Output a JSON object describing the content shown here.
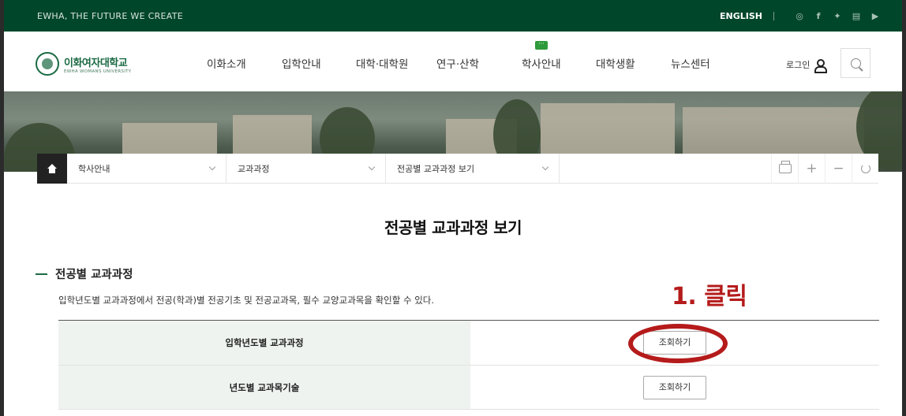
{
  "topbar": {
    "slogan": "EWHA, THE FUTURE WE CREATE",
    "english": "ENGLISH",
    "sns_icons": [
      "instagram-icon",
      "facebook-icon",
      "twitter-icon",
      "chat-icon",
      "youtube-icon"
    ]
  },
  "logo": {
    "name_ko": "이화여자대학교",
    "name_en": "EWHA WOMANS UNIVERSITY"
  },
  "nav": {
    "items": [
      {
        "label": "이화소개"
      },
      {
        "label": "입학안내"
      },
      {
        "label": "대학·대학원"
      },
      {
        "label": "연구·산학"
      },
      {
        "label": "학사안내",
        "badge": "···"
      },
      {
        "label": "대학생활"
      },
      {
        "label": "뉴스센터"
      }
    ],
    "login": "로그인"
  },
  "breadcrumb": {
    "items": [
      {
        "label": "학사안내"
      },
      {
        "label": "교과과정"
      },
      {
        "label": "전공별 교과과정 보기"
      }
    ]
  },
  "tools": [
    "print-icon",
    "zoom-in-icon",
    "zoom-out-icon",
    "refresh-icon"
  ],
  "page": {
    "title": "전공별 교과과정 보기",
    "section_title": "전공별 교과과정",
    "description": "입학년도별 교과과정에서 전공(학과)별 전공기초 및 전공교과목, 필수 교양교과목을 확인할 수 있다.",
    "annotation": "1. 클릭"
  },
  "table": {
    "rows": [
      {
        "label": "입학년도별 교과과정",
        "button": "조회하기"
      },
      {
        "label": "년도별 교과목기술",
        "button": "조회하기"
      }
    ]
  },
  "colors": {
    "brand_green": "#00462a",
    "annotation_red": "#b51b1b"
  }
}
